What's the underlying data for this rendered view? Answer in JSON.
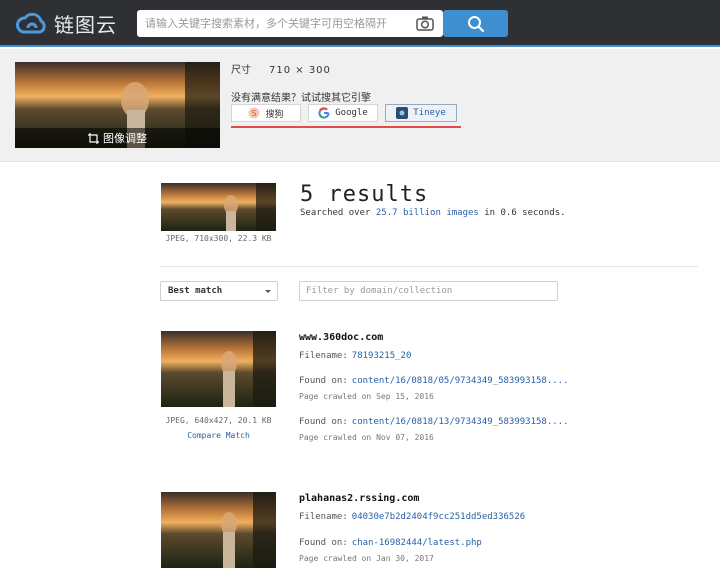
{
  "header": {
    "logo_text": "链图云",
    "search_placeholder": "请输入关键字搜索素材，多个关键字可用空格隔开",
    "accent_color": "#3e8ed0",
    "icons": [
      "cloud-logo-icon",
      "camera-icon",
      "search-icon"
    ]
  },
  "panel": {
    "thumb_caption": "图像调整",
    "size_label": "尺寸",
    "size_value": "710 × 300",
    "no_result_text": "没有满意结果？试试搜其它引擎",
    "engines": [
      "搜狗",
      "Google",
      "Tineye"
    ]
  },
  "summary": {
    "count": "5 results",
    "searched_prefix": "Searched over",
    "searched_link": "25.7 billion images",
    "searched_suffix": "in 0.6 seconds.",
    "query_meta": "JPEG, 710x300, 22.3 KB"
  },
  "controls": {
    "sort_label": "Best match",
    "filter_placeholder": "Filter by domain/collection"
  },
  "results": [
    {
      "domain": "www.360doc.com",
      "filename_label": "Filename:",
      "filename": "78193215_20",
      "meta": "JPEG, 640x427, 20.1 KB",
      "compare": "Compare Match",
      "found": [
        {
          "label": "Found on:",
          "link": "content/16/0818/05/9734349_583993158....",
          "crawled": "Page crawled on Sep 15, 2016"
        },
        {
          "label": "Found on:",
          "link": "content/16/0818/13/9734349_583993158....",
          "crawled": "Page crawled on Nov 07, 2016"
        }
      ]
    },
    {
      "domain": "plahanas2.rssing.com",
      "filename_label": "Filename:",
      "filename": "04030e7b2d2404f9cc251dd5ed336526",
      "found": [
        {
          "label": "Found on:",
          "link": "chan-16982444/latest.php",
          "crawled": "Page crawled on Jan 30, 2017"
        }
      ]
    }
  ]
}
